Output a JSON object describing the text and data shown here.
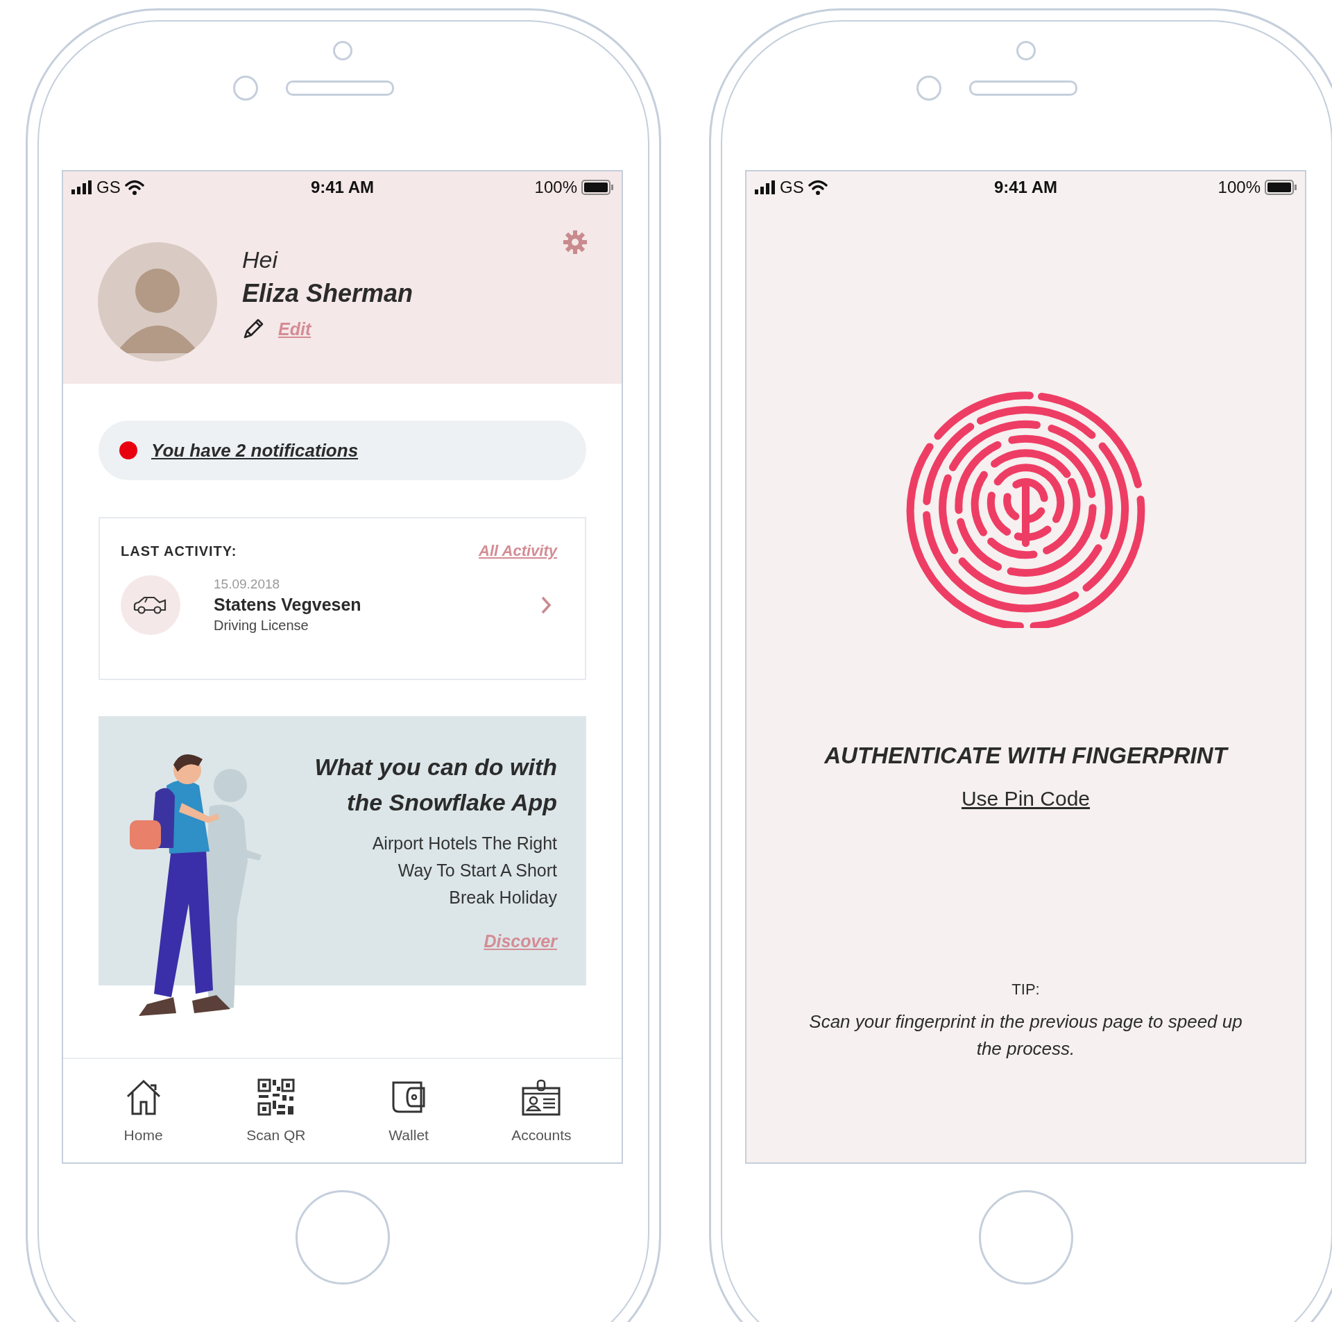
{
  "home_screen": {
    "status_bar": {
      "carrier": "GS",
      "time": "9:41 AM",
      "battery": "100%"
    },
    "profile": {
      "greeting": "Hei",
      "name": "Eliza Sherman",
      "edit_link": "Edit"
    },
    "notification": {
      "text": "You have 2 notifications",
      "unread": true
    },
    "last_activity": {
      "title": "LAST ACTIVITY:",
      "link": "All Activity",
      "items": [
        {
          "kind": "car",
          "date": "15.09.2018",
          "title": "Statens Vegvesen",
          "subtitle": "Driving License"
        }
      ]
    },
    "promo": {
      "title": "What you can do with the Snowflake App",
      "text": "Airport Hotels The Right Way To Start A Short Break Holiday",
      "link": "Discover"
    },
    "tab_bar": [
      {
        "kind": "home",
        "label": "Home"
      },
      {
        "kind": "qr",
        "label": "Scan QR"
      },
      {
        "kind": "wallet",
        "label": "Wallet"
      },
      {
        "kind": "id",
        "label": "Accounts"
      }
    ]
  },
  "auth_screen": {
    "status_bar": {
      "carrier": "GS",
      "time": "9:41 AM",
      "battery": "100%"
    },
    "title": "AUTHENTICATE WITH FINGERPRINT",
    "pin_link": "Use Pin Code",
    "tip_label": "TIP:",
    "tip_text": "Scan your fingerprint in the previous page to speed up the process."
  }
}
